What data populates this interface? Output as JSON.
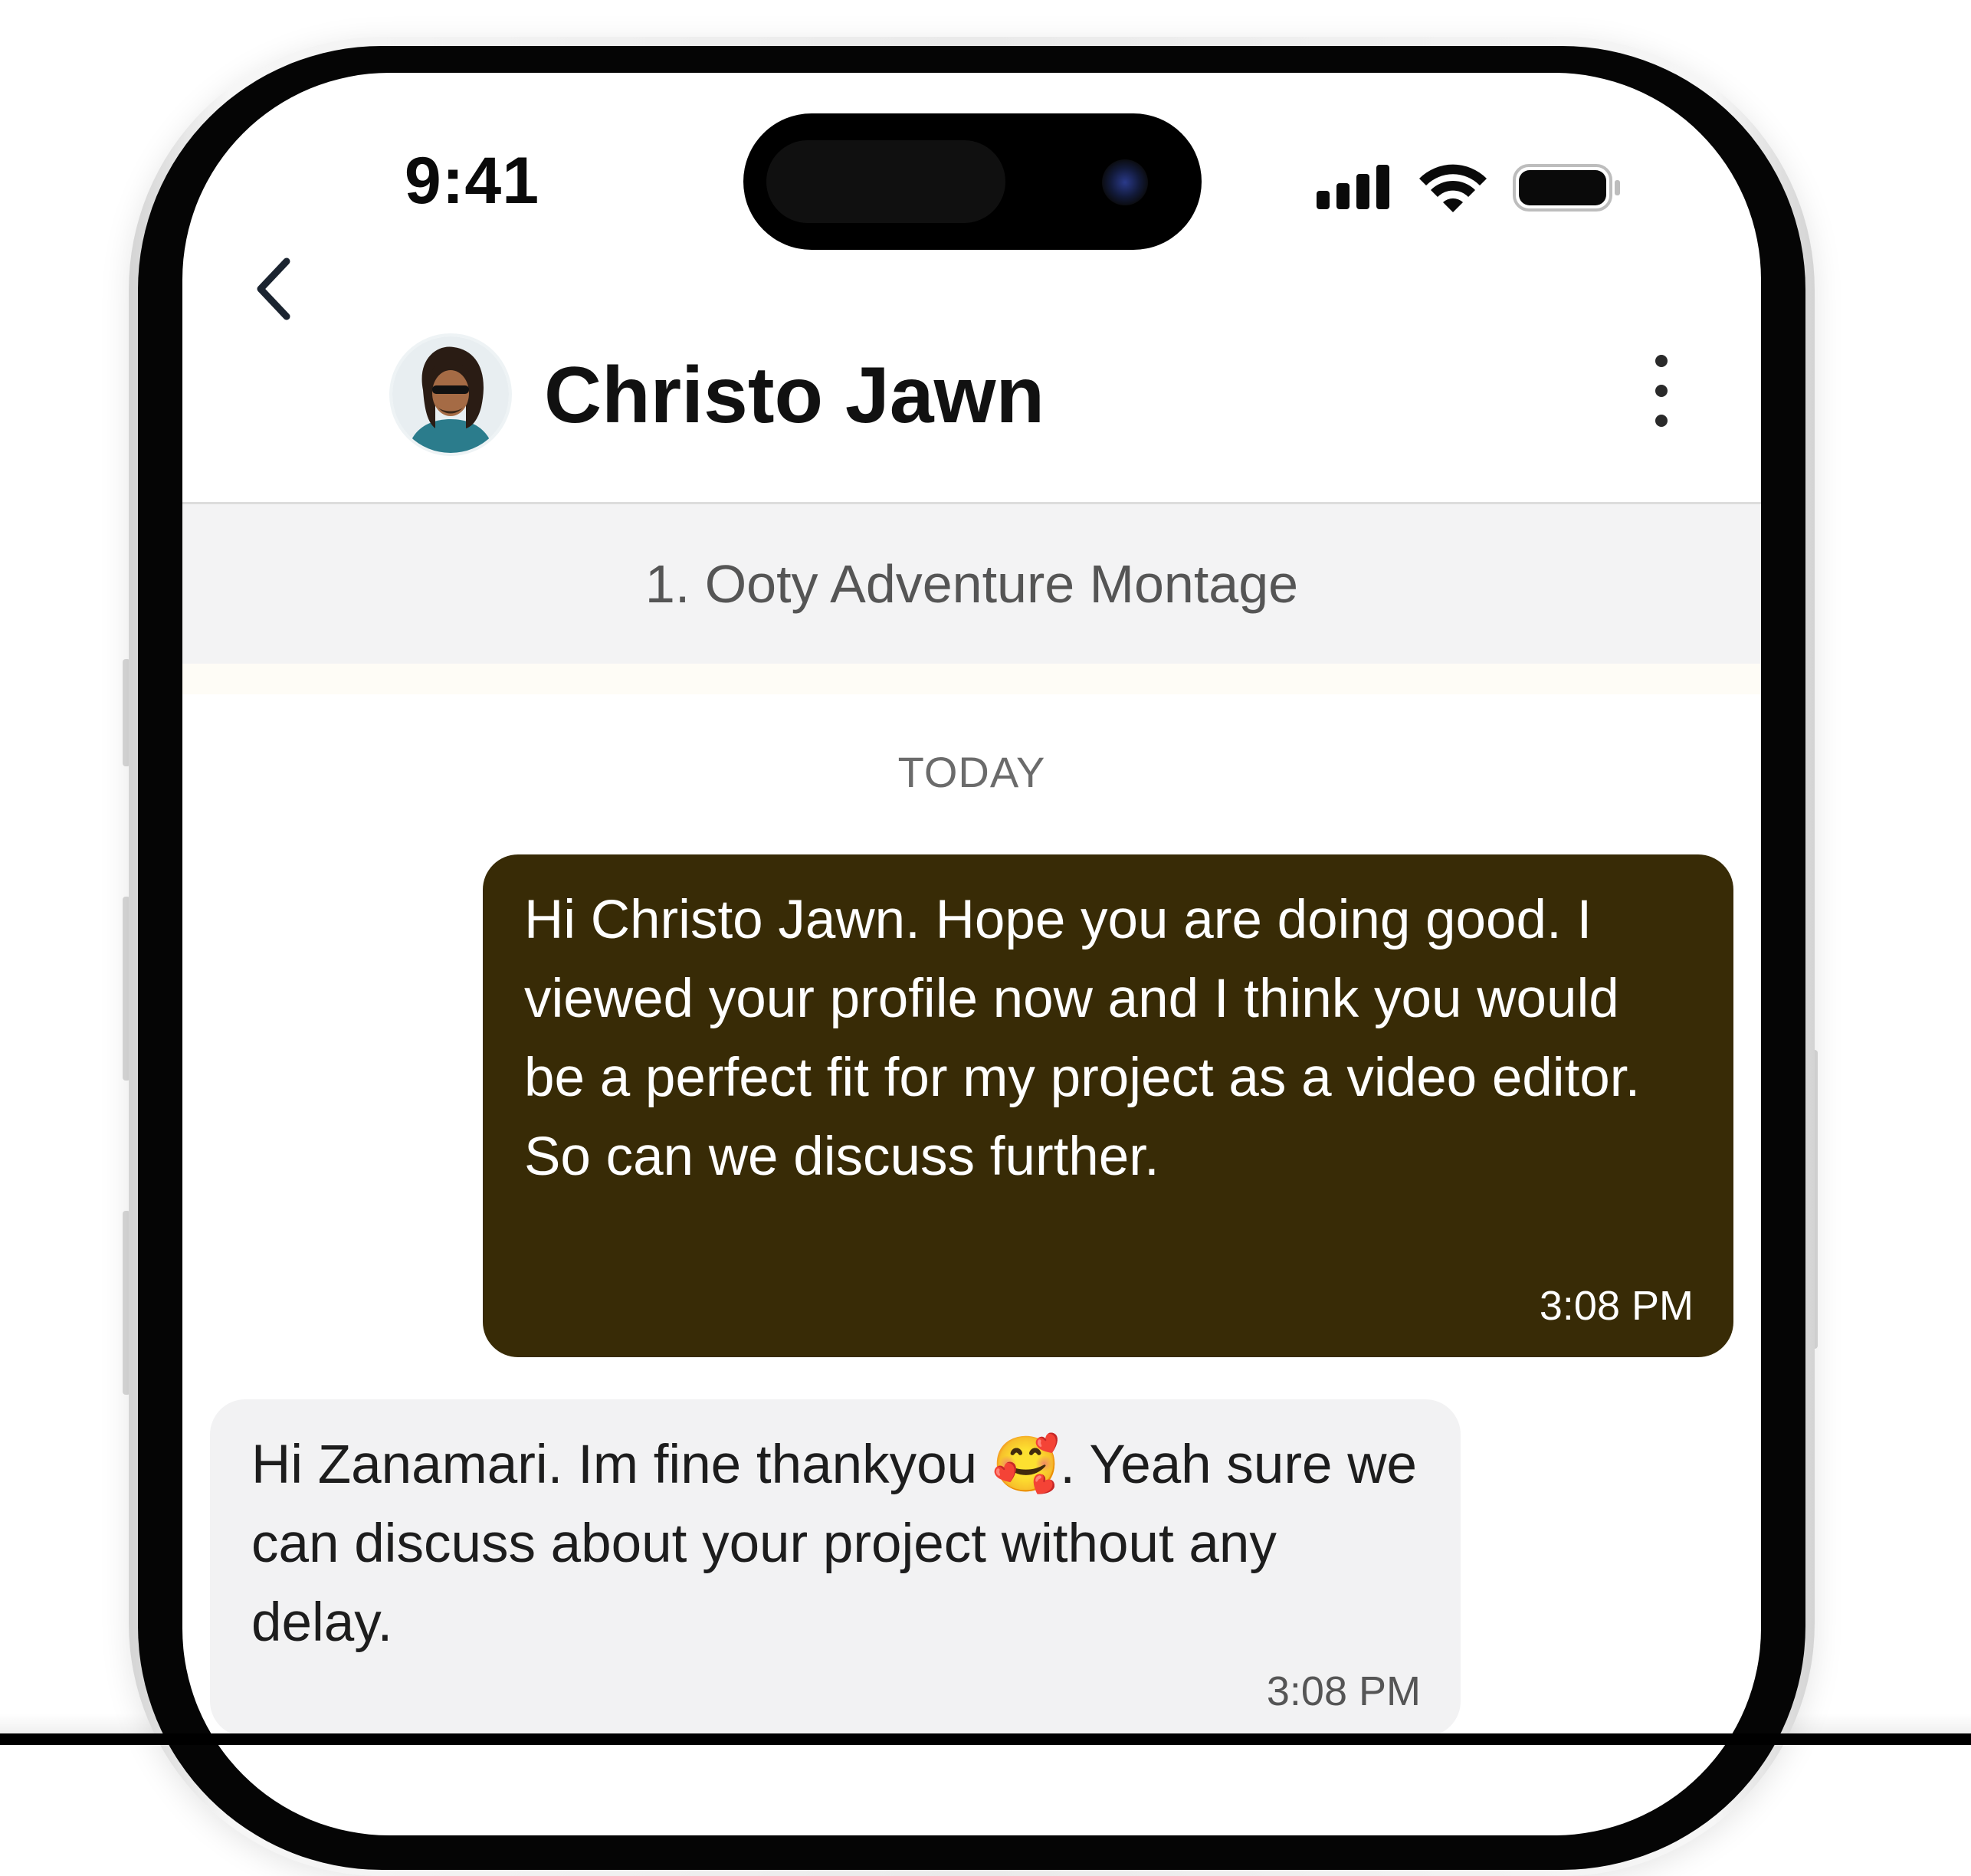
{
  "status_bar": {
    "time": "9:41"
  },
  "header": {
    "contact_name": "Christo Jawn",
    "back_icon": "chevron-left-icon",
    "menu_icon": "more-vertical-icon"
  },
  "project": {
    "title": "1. Ooty Adventure Montage"
  },
  "chat": {
    "date_label": "TODAY",
    "messages": [
      {
        "direction": "outgoing",
        "text": "Hi Christo Jawn. Hope you are doing good. I viewed your profile now and I think you would be a perfect fit for my project as a video editor. So can we discuss further.",
        "time": "3:08 PM"
      },
      {
        "direction": "incoming",
        "text_before_emoji": "Hi Zanamari. Im fine thankyou ",
        "emoji": "🥰",
        "text_after_emoji": ". Yeah sure we can discuss about your project without any delay.",
        "time": "3:08 PM"
      }
    ]
  },
  "colors": {
    "outgoing_bubble": "#382b06",
    "incoming_bubble": "#f2f2f3",
    "banner_bg": "#f3f3f4"
  }
}
